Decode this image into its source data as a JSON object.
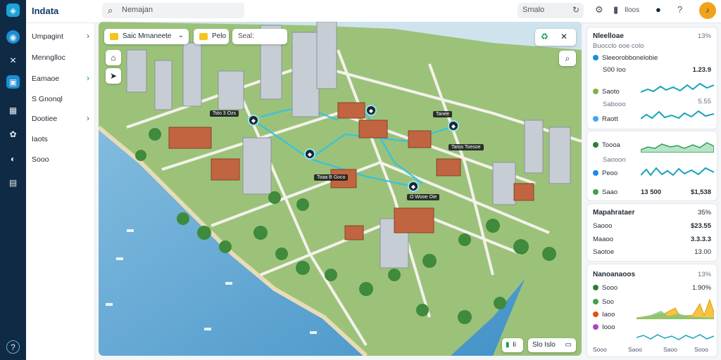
{
  "app": {
    "title": "Indata"
  },
  "search": {
    "placeholder": "Nemajan"
  },
  "topbar": {
    "search2": "Smalo",
    "user_text": "Iloos"
  },
  "sidebar": {
    "items": [
      {
        "label": "Umpagint",
        "chevron": "›"
      },
      {
        "label": "Mennglloc",
        "chevron": ""
      },
      {
        "label": "Eamaoe",
        "chevron": "›"
      },
      {
        "label": "S Gnonql",
        "chevron": ""
      },
      {
        "label": "Dootiee",
        "chevron": "›"
      },
      {
        "label": "Iaots",
        "chevron": ""
      },
      {
        "label": "Sooo",
        "chevron": ""
      }
    ]
  },
  "map": {
    "layer_select": "Saic Mmaneete",
    "chip2": "Pelo",
    "search_label": "Seal:",
    "pin_labels": [
      "Tsto 3 Ozs",
      "Toaa B Goco",
      "O Wooe Oie",
      "Tanee",
      "Taros Toesoe"
    ],
    "bottom_left": "Ii",
    "bottom_right": "Slo Islo"
  },
  "panels": {
    "p1": {
      "title": "Nleelloae",
      "subtitle": "Buocclo ooe colo",
      "title_value": "13%",
      "row1": "Sleeorobbonelobie",
      "row2_a": "S00 Ioo",
      "row2_b": "1.23.9",
      "row3_label": "Saoto",
      "row3_sub": "Sabooo",
      "row3_value": "5.55",
      "row4": "Raott"
    },
    "p2": {
      "row1": "Toooa",
      "row1_sub": "Saooon",
      "row2": "Peoo",
      "row3_label": "Saao",
      "row3_a": "13 500",
      "row3_b": "$1,538"
    },
    "p3": {
      "title": "Mapahrataer",
      "title_value": "35%",
      "row1_label": "Saooo",
      "row1_value": "$23.55",
      "row2_label": "Maaoo",
      "row2_value": "3.3.3.3",
      "row3_label": "Saotoe",
      "row3_value": "13.00"
    },
    "p4": {
      "title": "Nanoanaoos",
      "title_value": "13%",
      "row1_label": "Sooo",
      "row1_value": "1.90%",
      "row2_label": "Soo",
      "row3_label": "Iaoo",
      "row4_label": "Iooo",
      "row5_a": "Sooo",
      "row5_b": "Saoo",
      "row5_c": "Saoo",
      "row5_d": "Sooo"
    }
  },
  "colors": {
    "accent": "#0f2a44",
    "brand": "#1aa3d9",
    "positive": "#0e9a5a",
    "warning": "#f0a41c",
    "water": "#4f9fd0"
  }
}
